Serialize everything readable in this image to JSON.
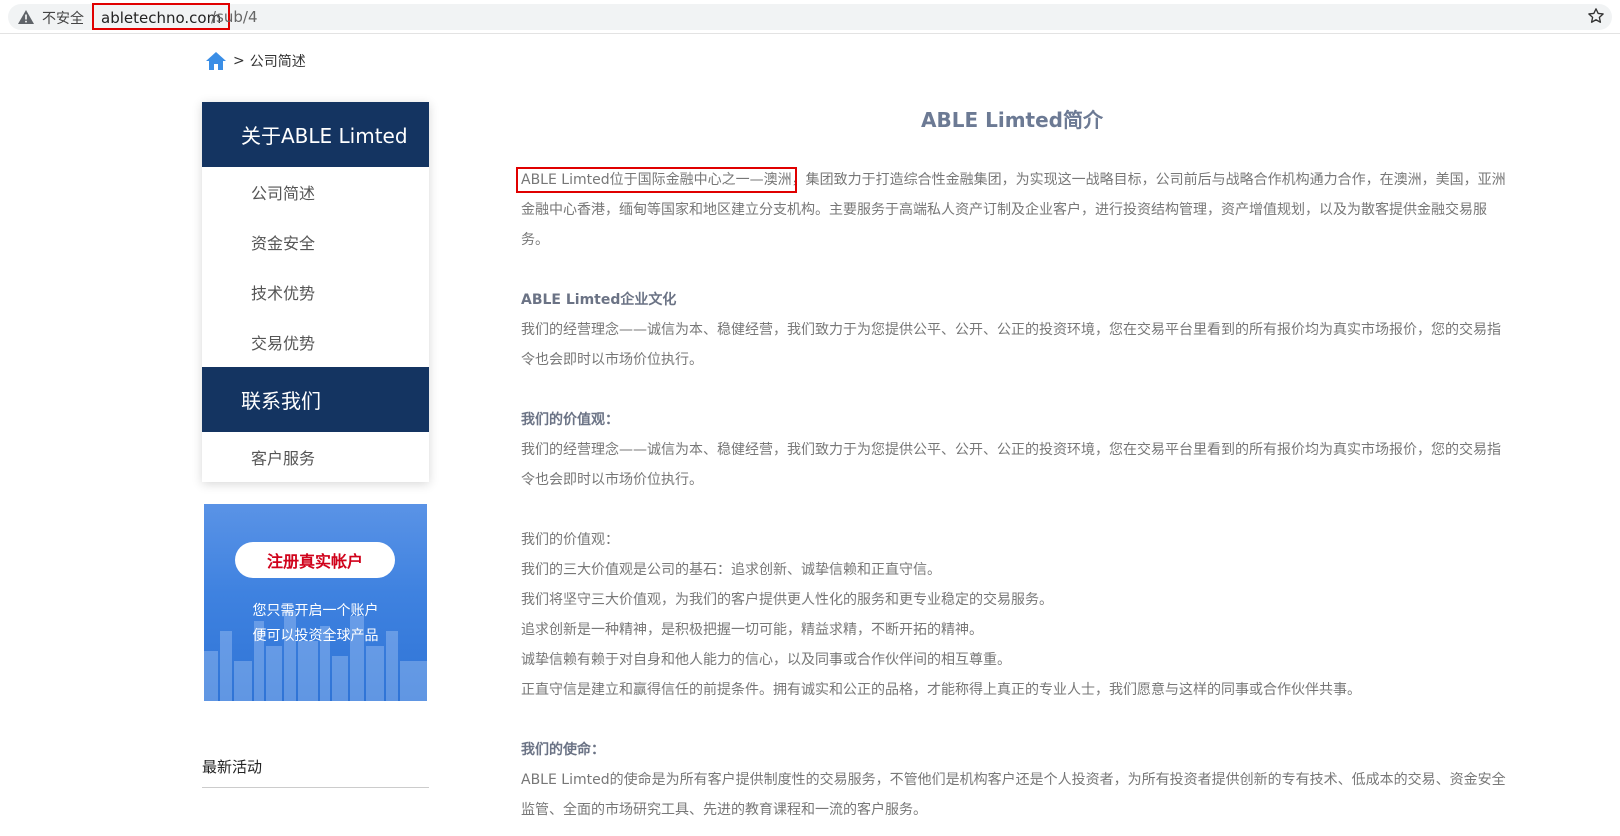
{
  "browser": {
    "insecure_label": "不安全",
    "url_domain": "abletechno.com",
    "url_path": "/sub/4"
  },
  "breadcrumb": {
    "separator": ">",
    "current": "公司简述"
  },
  "sidebar": {
    "about_header": "关于ABLE Limted",
    "about_items": [
      {
        "label": "公司简述"
      },
      {
        "label": "资金安全"
      },
      {
        "label": "技术优势"
      },
      {
        "label": "交易优势"
      }
    ],
    "contact_header": "联系我们",
    "contact_items": [
      {
        "label": "客户服务"
      }
    ]
  },
  "promo": {
    "button_label": "注册真实帐户",
    "line1": "您只需开启一个账户",
    "line2": "便可以投资全球产品"
  },
  "news": {
    "title": "最新活动"
  },
  "main": {
    "title": "ABLE Limted简介",
    "intro_highlight": "ABLE Limted位于国际金融中心之一—澳洲",
    "intro_rest": "，集团致力于打造综合性金融集团，为实现这一战略目标，公司前后与战略合作机构通力合作，在澳洲，美国，亚洲金融中心香港，缅甸等国家和地区建立分支机构。主要服务于高端私人资产订制及企业客户，进行投资结构管理，资产增值规划，以及为散客提供金融交易服务。",
    "culture_heading": "ABLE Limted企业文化",
    "culture_text": "我们的经营理念——诚信为本、稳健经营，我们致力于为您提供公平、公开、公正的投资环境，您在交易平台里看到的所有报价均为真实市场报价，您的交易指令也会即时以市场价位执行。",
    "values_heading": "我们的价值观：",
    "values_text": "我们的经营理念——诚信为本、稳健经营，我们致力于为您提供公平、公开、公正的投资环境，您在交易平台里看到的所有报价均为真实市场报价，您的交易指令也会即时以市场价位执行。",
    "values2_heading": "我们的价值观：",
    "values2_lines": [
      "我们的三大价值观是公司的基石：追求创新、诚挚信赖和正直守信。",
      "我们将坚守三大价值观，为我们的客户提供更人性化的服务和更专业稳定的交易服务。",
      "追求创新是一种精神，是积极把握一切可能，精益求精，不断开拓的精神。",
      "诚挚信赖有赖于对自身和他人能力的信心，以及同事或合作伙伴间的相互尊重。",
      "正直守信是建立和赢得信任的前提条件。拥有诚实和公正的品格，才能称得上真正的专业人士，我们愿意与这样的同事或合作伙伴共事。"
    ],
    "mission_heading": "我们的使命：",
    "mission_text": "ABLE Limted的使命是为所有客户提供制度性的交易服务，不管他们是机构客户还是个人投资者，为所有投资者提供创新的专有技术、低成本的交易、资金安全监管、全面的市场研究工具、先进的教育课程和一流的客户服务。"
  }
}
